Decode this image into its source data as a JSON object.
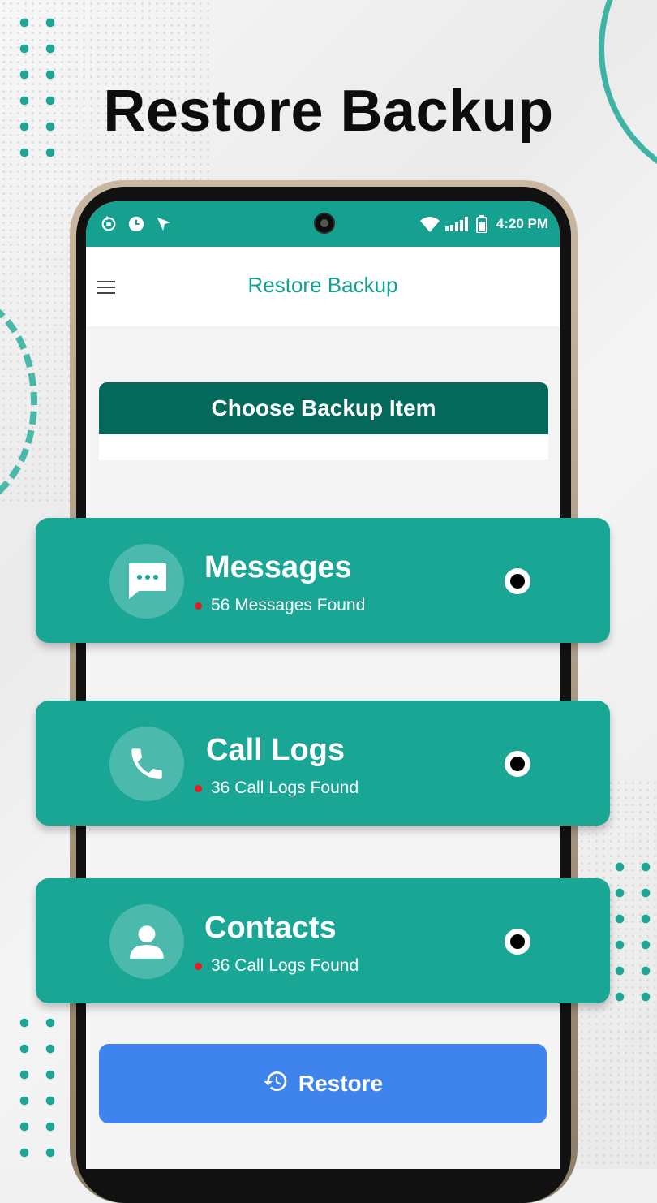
{
  "headline": "Restore Backup",
  "status_bar": {
    "time": "4:20 PM"
  },
  "app_bar": {
    "title": "Restore Backup"
  },
  "section_title": "Choose Backup Item",
  "items": [
    {
      "title": "Messages",
      "subtitle": "56 Messages Found",
      "icon": "message-icon",
      "selected": true
    },
    {
      "title": "Call Logs",
      "subtitle": "36 Call Logs Found",
      "icon": "phone-icon",
      "selected": true
    },
    {
      "title": "Contacts",
      "subtitle": "36 Call Logs Found",
      "icon": "person-icon",
      "selected": true
    }
  ],
  "restore_button": {
    "label": "Restore",
    "icon": "history-icon"
  },
  "colors": {
    "teal": "#19a694",
    "dark_teal": "#04685a",
    "blue": "#3f84ec",
    "red_dot": "#e21d25"
  }
}
